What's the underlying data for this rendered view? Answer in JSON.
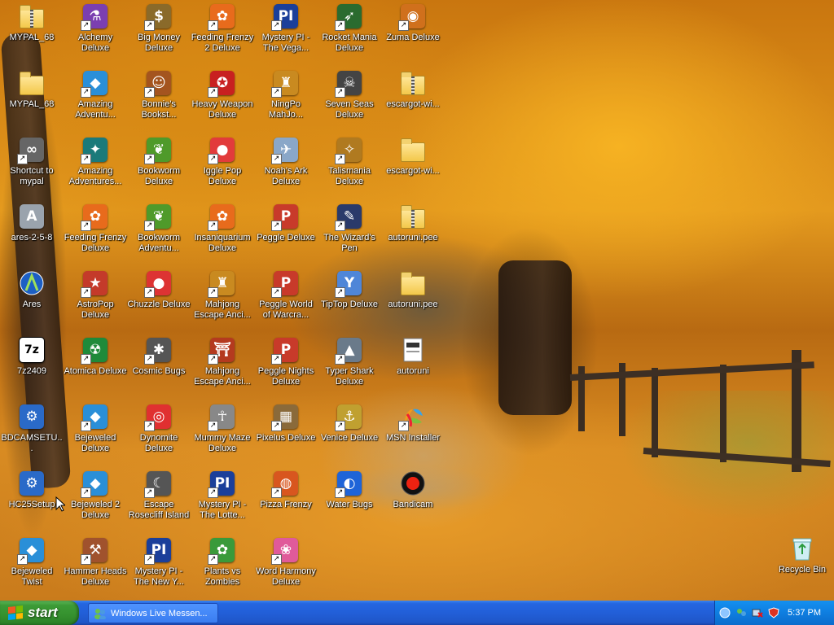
{
  "desktop": {
    "icons": [
      {
        "label": "MYPAL_68",
        "icon": "zip-folder-icon"
      },
      {
        "label": "Alchemy Deluxe",
        "icon": "alchemy-icon"
      },
      {
        "label": "Big Money Deluxe",
        "icon": "money-bag-icon"
      },
      {
        "label": "Feeding Frenzy 2 Deluxe",
        "icon": "fish-icon"
      },
      {
        "label": "Mystery PI - The Vega...",
        "icon": "mystery-pi-icon"
      },
      {
        "label": "Rocket Mania Deluxe",
        "icon": "rocket-icon"
      },
      {
        "label": "Zuma Deluxe",
        "icon": "zuma-icon"
      },
      {
        "label": "MYPAL_68",
        "icon": "folder-icon"
      },
      {
        "label": "Amazing Adventu...",
        "icon": "gem-icon"
      },
      {
        "label": "Bonnie's Bookst...",
        "icon": "bonnie-icon"
      },
      {
        "label": "Heavy Weapon Deluxe",
        "icon": "weapon-icon"
      },
      {
        "label": "NingPo MahJo...",
        "icon": "mahjong-icon"
      },
      {
        "label": "Seven Seas Deluxe",
        "icon": "pirate-icon"
      },
      {
        "label": "escargot-wi...",
        "icon": "zip-folder-icon"
      },
      {
        "label": "Shortcut to mypal",
        "icon": "mypal-icon"
      },
      {
        "label": "Amazing Adventures...",
        "icon": "compass-icon"
      },
      {
        "label": "Bookworm Deluxe",
        "icon": "bookworm-icon"
      },
      {
        "label": "Iggle Pop Deluxe",
        "icon": "iggle-icon"
      },
      {
        "label": "Noah's Ark Deluxe",
        "icon": "dove-icon"
      },
      {
        "label": "Talismania Deluxe",
        "icon": "talisman-icon"
      },
      {
        "label": "escargot-wi...",
        "icon": "folder-icon"
      },
      {
        "label": "ares-2-5-8",
        "icon": "installer-icon"
      },
      {
        "label": "Feeding Frenzy Deluxe",
        "icon": "fish-icon"
      },
      {
        "label": "Bookworm Adventu...",
        "icon": "bookworm-icon"
      },
      {
        "label": "Insaniquarium Deluxe",
        "icon": "fish-icon"
      },
      {
        "label": "Peggle Deluxe",
        "icon": "peggle-icon"
      },
      {
        "label": "The Wizard's Pen",
        "icon": "wizard-icon"
      },
      {
        "label": "autoruni.pee",
        "icon": "zip-folder-icon"
      },
      {
        "label": "Ares",
        "icon": "ares-icon"
      },
      {
        "label": "AstroPop Deluxe",
        "icon": "astropop-icon"
      },
      {
        "label": "Chuzzle Deluxe",
        "icon": "chuzzle-icon"
      },
      {
        "label": "Mahjong Escape Anci...",
        "icon": "mahjong-icon"
      },
      {
        "label": "Peggle World of Warcra...",
        "icon": "peggle-icon"
      },
      {
        "label": "TipTop Deluxe",
        "icon": "cocktail-icon"
      },
      {
        "label": "autoruni.pee",
        "icon": "folder-icon"
      },
      {
        "label": "7z2409",
        "icon": "7z-icon"
      },
      {
        "label": "Atomica Deluxe",
        "icon": "atom-icon"
      },
      {
        "label": "Cosmic Bugs",
        "icon": "bug-icon"
      },
      {
        "label": "Mahjong Escape Anci...",
        "icon": "gate-icon"
      },
      {
        "label": "Peggle Nights Deluxe",
        "icon": "peggle-icon"
      },
      {
        "label": "Typer Shark Deluxe",
        "icon": "shark-icon"
      },
      {
        "label": "autoruni",
        "icon": "document-icon"
      },
      {
        "label": "BDCAMSETU...",
        "icon": "setup-icon"
      },
      {
        "label": "Bejeweled Deluxe",
        "icon": "gem-icon"
      },
      {
        "label": "Dynomite Deluxe",
        "icon": "egg-icon"
      },
      {
        "label": "Mummy Maze Deluxe",
        "icon": "mummy-icon"
      },
      {
        "label": "Pixelus Deluxe",
        "icon": "pixelus-icon"
      },
      {
        "label": "Venice Deluxe",
        "icon": "venice-icon"
      },
      {
        "label": "MSN Installer",
        "icon": "msn-icon"
      },
      {
        "label": "HC25Setup",
        "icon": "setup-icon"
      },
      {
        "label": "Bejeweled 2 Deluxe",
        "icon": "gem-icon"
      },
      {
        "label": "Escape Rosecliff Island",
        "icon": "escape-icon"
      },
      {
        "label": "Mystery PI - The Lotte...",
        "icon": "mystery-pi-icon"
      },
      {
        "label": "Pizza Frenzy",
        "icon": "pizza-icon"
      },
      {
        "label": "Water Bugs",
        "icon": "water-icon"
      },
      {
        "label": "Bandicam",
        "icon": "record-icon"
      },
      {
        "label": "Bejeweled Twist",
        "icon": "gem-icon"
      },
      {
        "label": "Hammer Heads Deluxe",
        "icon": "hammer-icon"
      },
      {
        "label": "Mystery PI - The New Y...",
        "icon": "mystery-pi-icon"
      },
      {
        "label": "Plants vs Zombies",
        "icon": "plant-icon"
      },
      {
        "label": "Word Harmony Deluxe",
        "icon": "flower-icon"
      }
    ],
    "recycle_bin": {
      "label": "Recycle Bin",
      "icon": "recycle-bin-icon"
    }
  },
  "taskbar": {
    "start_label": "start",
    "task_button": "Windows Live Messen...",
    "clock": "5:37 PM"
  }
}
